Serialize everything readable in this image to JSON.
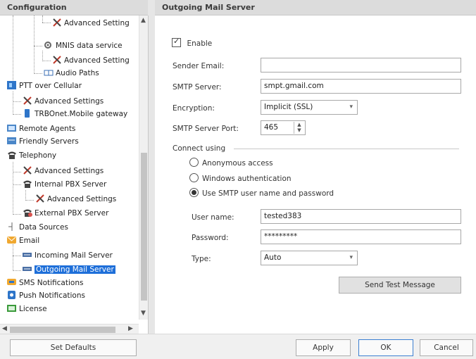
{
  "left_panel": {
    "title": "Configuration"
  },
  "right_panel": {
    "title": "Outgoing Mail Server"
  },
  "tree": {
    "items": [
      {
        "label": "Advanced Setting",
        "icon": "wrench-icon"
      },
      {
        "label": "MNIS data service",
        "icon": "gear-icon"
      },
      {
        "label": "Advanced Setting",
        "icon": "wrench-icon"
      },
      {
        "label": "Audio Paths",
        "icon": "audio-paths-icon"
      },
      {
        "label": "PTT over Cellular",
        "icon": "ptt-icon"
      },
      {
        "label": "Advanced Settings",
        "icon": "wrench-icon"
      },
      {
        "label": "TRBOnet.Mobile gateway",
        "icon": "mobile-icon"
      },
      {
        "label": "Remote Agents",
        "icon": "remote-agents-icon"
      },
      {
        "label": "Friendly Servers",
        "icon": "servers-icon"
      },
      {
        "label": "Telephony",
        "icon": "telephone-icon"
      },
      {
        "label": "Advanced Settings",
        "icon": "wrench-icon"
      },
      {
        "label": "Internal PBX Server",
        "icon": "telephone-icon"
      },
      {
        "label": "Advanced Settings",
        "icon": "wrench-icon"
      },
      {
        "label": "External PBX Server",
        "icon": "external-pbx-icon"
      },
      {
        "label": "Data Sources",
        "icon": "data-sources-icon"
      },
      {
        "label": "Email",
        "icon": "email-icon"
      },
      {
        "label": "Incoming Mail Server",
        "icon": "mail-server-icon"
      },
      {
        "label": "Outgoing Mail Server",
        "icon": "mail-server-icon"
      },
      {
        "label": "SMS Notifications",
        "icon": "sms-icon"
      },
      {
        "label": "Push Notifications",
        "icon": "push-icon"
      },
      {
        "label": "License",
        "icon": "license-icon"
      }
    ],
    "selected_index": 17
  },
  "form": {
    "enable_label": "Enable",
    "enable_checked": true,
    "sender_email_label": "Sender Email:",
    "sender_email_value": "",
    "smtp_server_label": "SMTP Server:",
    "smtp_server_value": "smpt.gmail.com",
    "encryption_label": "Encryption:",
    "encryption_value": "Implicit (SSL)",
    "smtp_port_label": "SMTP Server Port:",
    "smtp_port_value": "465",
    "connect_using_label": "Connect using",
    "radio_anonymous": "Anonymous access",
    "radio_windows": "Windows authentication",
    "radio_smtp": "Use SMTP user name and password",
    "selected_radio": "radio_smtp",
    "username_label": "User name:",
    "username_value": "tested383",
    "password_label": "Password:",
    "password_value": "*********",
    "type_label": "Type:",
    "type_value": "Auto",
    "send_test_label": "Send Test Message"
  },
  "bottom": {
    "set_defaults": "Set Defaults",
    "apply": "Apply",
    "ok": "OK",
    "cancel": "Cancel"
  },
  "colors": {
    "selection": "#1e6fd9",
    "header_bg": "#dcdcdc"
  }
}
